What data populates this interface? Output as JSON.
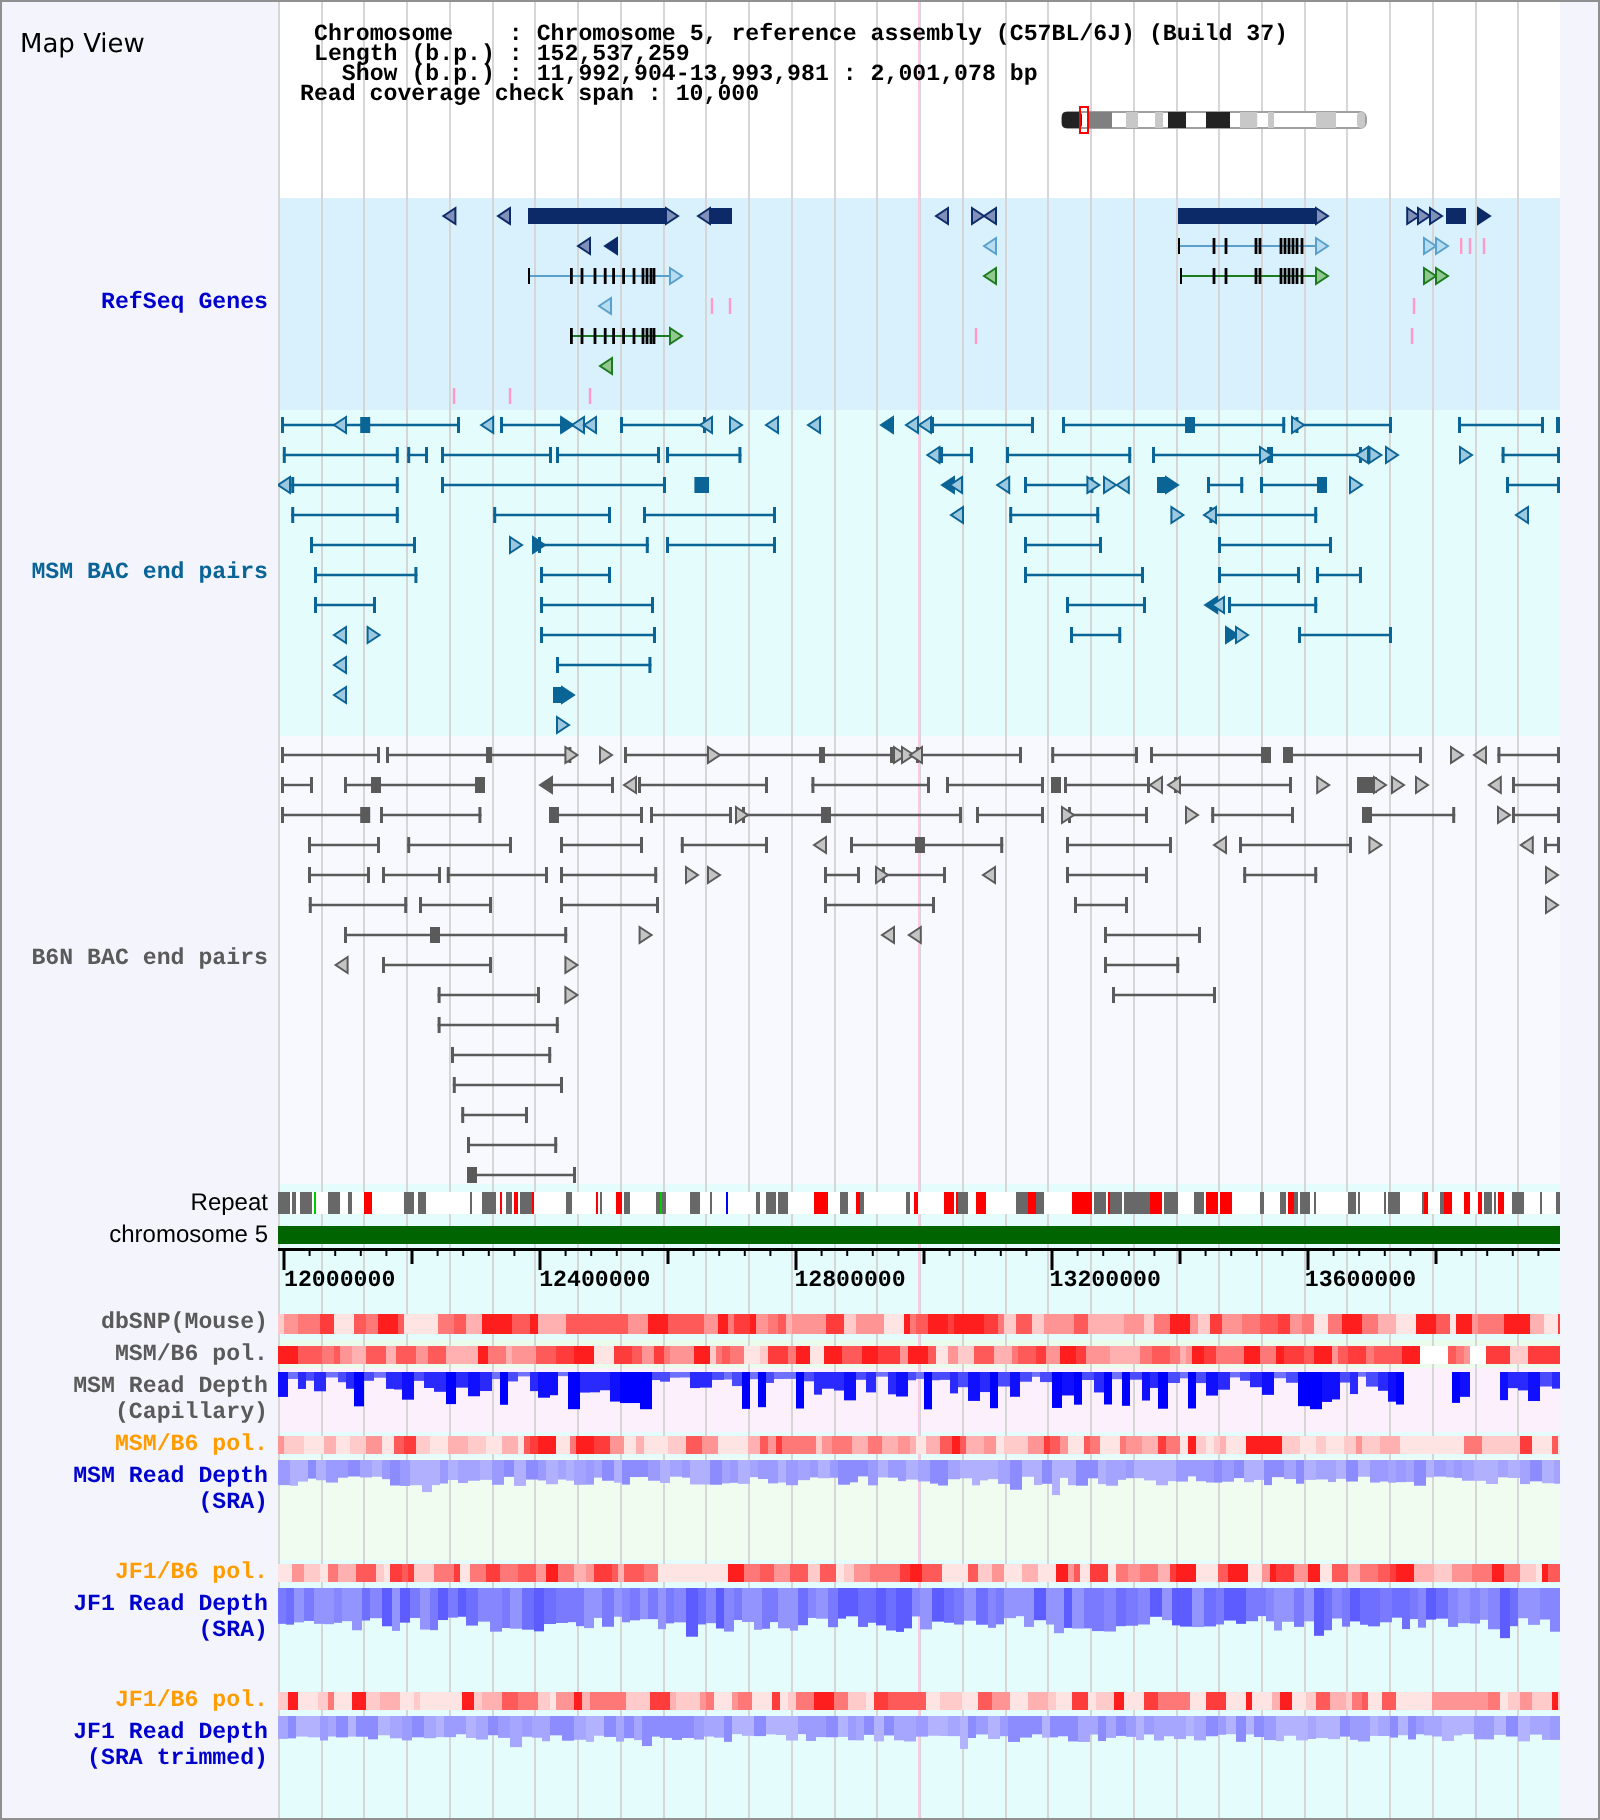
{
  "title": "Map View",
  "info_lines": [
    "Chromosome    : Chromosome 5, reference assembly (C57BL/6J) (Build 37)",
    "Length (b.p.) : 152,537,259",
    "  Show (b.p.) : 11,992,904-13,993,981 : 2,001,078 bp"
  ],
  "coverage_note": "Read coverage check span : 10,000",
  "feature_tracks": [
    {
      "label": "RefSeq Genes",
      "kind": "genes"
    },
    {
      "label": "MSM BAC end pairs",
      "kind": "msm_bac"
    },
    {
      "label": "B6N BAC end pairs",
      "kind": "b6n_bac"
    }
  ],
  "repeat_track": {
    "label": "Repeat"
  },
  "chromosome_track": {
    "label": "chromosome 5"
  },
  "axis": {
    "ticks": [
      "12000000",
      "12400000",
      "12800000",
      "13200000",
      "13600000"
    ]
  },
  "data_tracks": [
    {
      "label_lines": [
        "dbSNP(Mouse)"
      ],
      "kind": "snp"
    },
    {
      "label_lines": [
        "MSM/B6 pol."
      ],
      "kind": "capillary_pol"
    },
    {
      "label_lines": [
        "MSM Read Depth",
        "(Capillary)"
      ],
      "kind": "capillary_depth"
    },
    {
      "label_lines": [
        "MSM/B6 pol."
      ],
      "kind": "sra_pol"
    },
    {
      "label_lines": [
        "MSM Read Depth",
        "(SRA)"
      ],
      "kind": "sra_depth"
    },
    {
      "label_lines": [
        "JF1/B6 pol."
      ],
      "kind": "sra_pol"
    },
    {
      "label_lines": [
        "JF1 Read Depth",
        "(SRA)"
      ],
      "kind": "sra_depth"
    },
    {
      "label_lines": [
        "JF1/B6 pol."
      ],
      "kind": "sra_pol"
    },
    {
      "label_lines": [
        "JF1 Read Depth",
        "(SRA trimmed)"
      ],
      "kind": "sra_depth"
    }
  ]
}
